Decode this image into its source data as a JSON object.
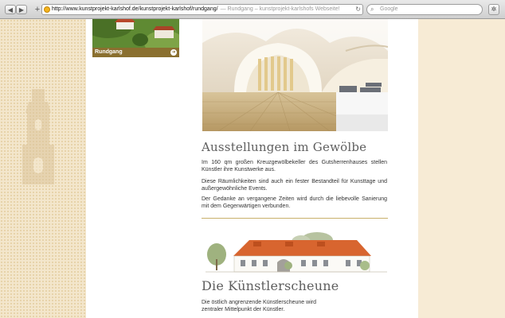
{
  "browser": {
    "back_icon": "back-arrow-icon",
    "forward_icon": "forward-arrow-icon",
    "add_icon": "plus-icon",
    "url": "http://www.kunstprojekt-karlshof.de/kunstprojekt-karlshof/rundgang/",
    "page_title": "— Rundgang – kunstprojekt-karlshofs Webseite!",
    "search_placeholder": "Google"
  },
  "sidebar": {
    "teaser_label": "Rundgang"
  },
  "section_gewoelbe": {
    "title": "Ausstellungen im Gewölbe",
    "paragraphs": [
      "Im 160 qm großen Kreuzgewölbekeller des Gutsherrenhauses stellen Künstler ihre Kunstwerke aus.",
      "Diese Räumlichkeiten sind auch ein fester Bestandteil für Kunsttage und außergewöhnliche Events.",
      "Der Gedanke an vergangene Zeiten wird durch die liebevolle Sanierung mit dem Gegenwärtigen verbunden."
    ]
  },
  "section_scheune": {
    "title": "Die Künstlerscheune",
    "paragraph": "Die östlich angrenzende Künstlerscheune wird zentraler Mittelpunkt der Künstler."
  },
  "colors": {
    "accent_rule": "#c9b06b",
    "title_text": "#5e5e5e",
    "left_pattern": "#f3e6cc"
  }
}
